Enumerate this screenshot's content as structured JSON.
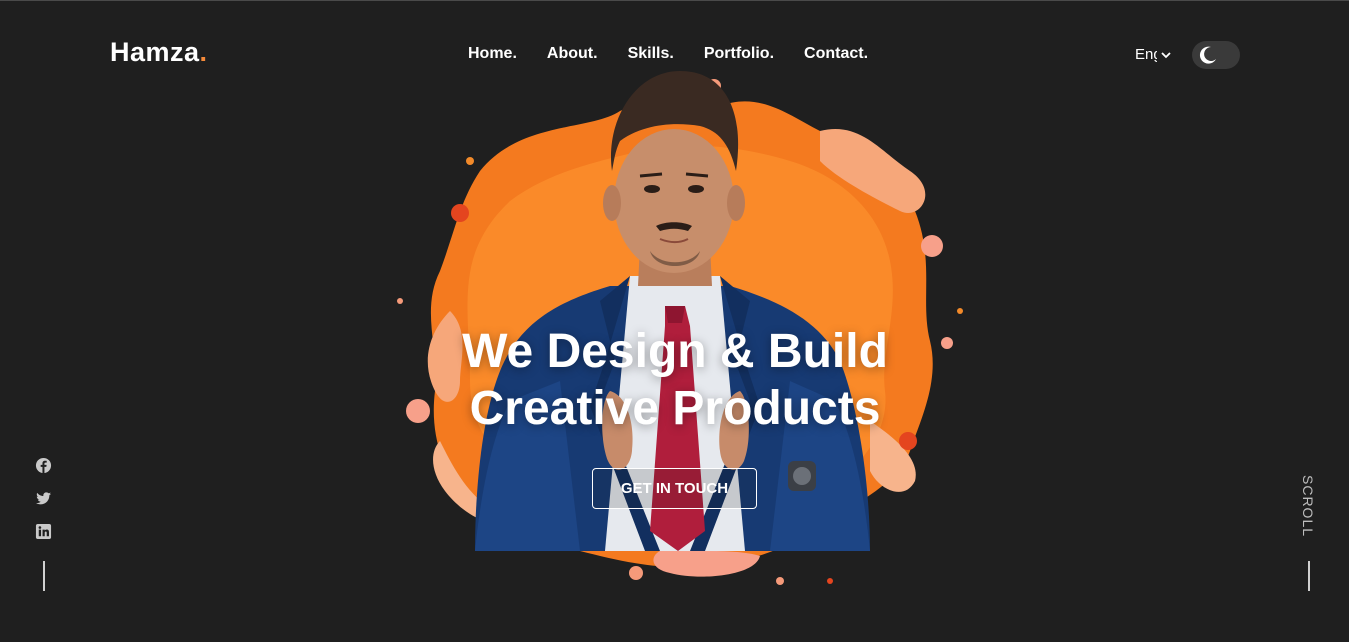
{
  "header": {
    "logo_text": "Hamza",
    "logo_dot": ".",
    "nav": [
      {
        "label": "Home."
      },
      {
        "label": "About."
      },
      {
        "label": "Skills."
      },
      {
        "label": "Portfolio."
      },
      {
        "label": "Contact."
      }
    ],
    "language": "English",
    "theme_toggle_icon": "moon-icon"
  },
  "hero": {
    "headline_line1": "We Design & Build",
    "headline_line2": "Creative Products",
    "cta_label": "GET IN TOUCH",
    "image_subject": "portrait-on-orange-paint-splash"
  },
  "social": {
    "icons": [
      "facebook-icon",
      "twitter-icon",
      "linkedin-icon"
    ]
  },
  "scroll_label": "SCROLL",
  "colors": {
    "background": "#1f1f1f",
    "accent": "#f58a3a",
    "text": "#ffffff"
  }
}
